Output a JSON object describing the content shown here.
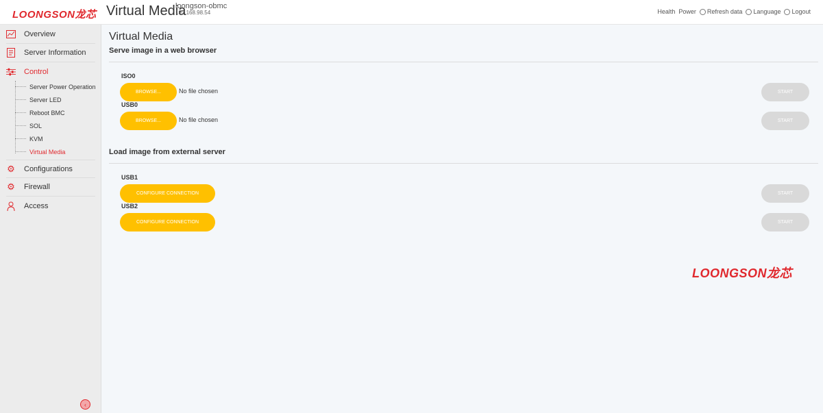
{
  "header": {
    "brand": "LOONGSON龙芯",
    "page_title": "Virtual Media",
    "hostname": "loongson-obmc",
    "ip": "192.168.98.54",
    "actions": {
      "health": "Health",
      "power": "Power",
      "refresh": "Refresh data",
      "language": "Language",
      "logout": "Logout"
    }
  },
  "sidebar": {
    "items": [
      {
        "label": "Overview",
        "icon": "chart-line-icon"
      },
      {
        "label": "Server Information",
        "icon": "server-doc-icon"
      },
      {
        "label": "Control",
        "icon": "sliders-icon",
        "active": true
      },
      {
        "label": "Configurations",
        "icon": "gear-icon"
      },
      {
        "label": "Firewall",
        "icon": "gear-icon"
      },
      {
        "label": "Access",
        "icon": "user-icon"
      }
    ],
    "control_sub": [
      "Server Power Operation",
      "Server LED",
      "Reboot BMC",
      "SOL",
      "KVM",
      "Virtual Media"
    ],
    "active_sub": "Virtual Media"
  },
  "main": {
    "title": "Virtual Media",
    "section1": {
      "title": "Serve image in a web browser",
      "devices": [
        {
          "name": "ISO0",
          "button": "BROWSE...",
          "file": "No file chosen",
          "start": "START"
        },
        {
          "name": "USB0",
          "button": "BROWSE...",
          "file": "No file chosen",
          "start": "START"
        }
      ]
    },
    "section2": {
      "title": "Load image from external server",
      "devices": [
        {
          "name": "USB1",
          "button": "CONFIGURE CONNECTION",
          "start": "START"
        },
        {
          "name": "USB2",
          "button": "CONFIGURE CONNECTION",
          "start": "START"
        }
      ]
    },
    "footer_logo": "LOONGSON龙芯"
  },
  "colors": {
    "accent": "#e0282d",
    "button": "#ffc000",
    "disabled": "#d9d9d9"
  }
}
